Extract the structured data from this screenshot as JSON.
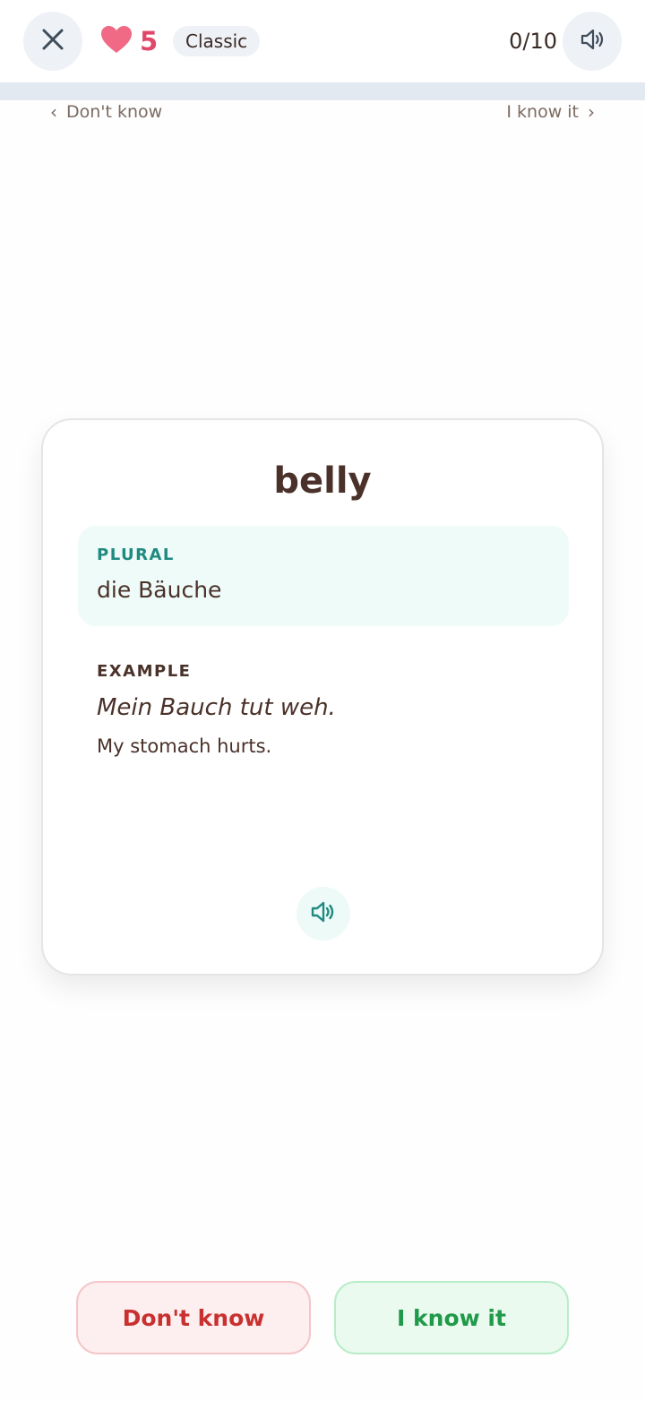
{
  "header": {
    "close_icon": "close-icon",
    "lives_count": "5",
    "mode_label": "Classic",
    "progress_text": "0/10",
    "progress_fraction": 0,
    "sound_icon": "speaker-icon"
  },
  "hints": {
    "left_label": "Don't know",
    "right_label": "I know it"
  },
  "card": {
    "word": "belly",
    "plural_label": "PLURAL",
    "plural_value": "die Bäuche",
    "example_label": "EXAMPLE",
    "example_sentence": "Mein Bauch tut weh.",
    "example_translation": "My stomach hurts."
  },
  "actions": {
    "dont_know_label": "Don't know",
    "know_it_label": "I know it"
  },
  "colors": {
    "heart": "#f06a85",
    "lives_text": "#e0486a",
    "accent_teal": "#1f8a80",
    "dont_know": "#c8312f",
    "know_it": "#21994a"
  }
}
